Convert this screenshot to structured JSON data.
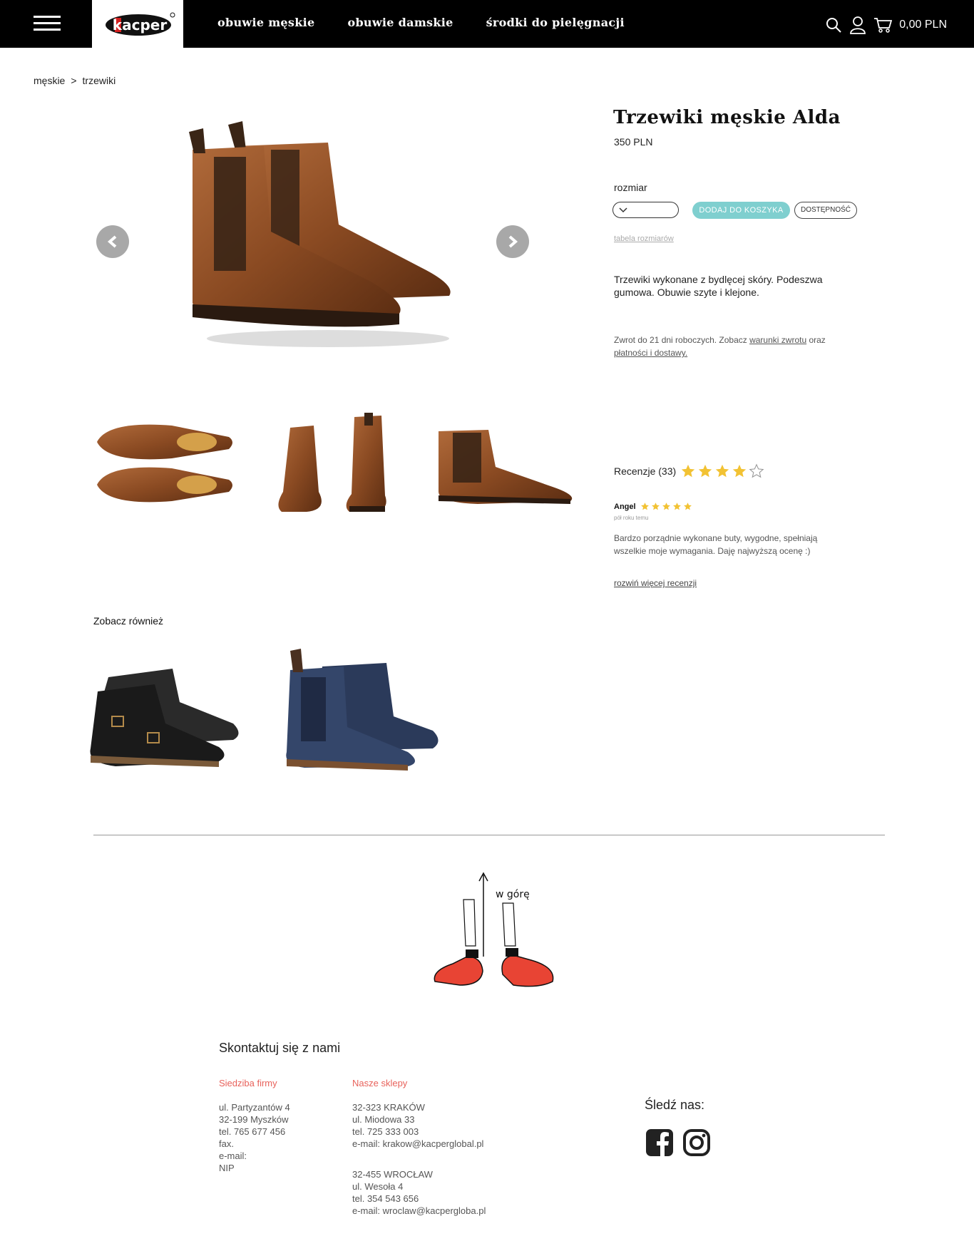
{
  "header": {
    "logo_text": "kacper",
    "nav": [
      "obuwie męskie",
      "obuwie damskie",
      "środki do pielęgnacji"
    ],
    "cart_total": "0,00 PLN"
  },
  "breadcrumb": {
    "items": [
      "męskie",
      "trzewiki"
    ],
    "separator": ">"
  },
  "product": {
    "title": "Trzewiki męskie Alda",
    "price": "350 PLN",
    "size_label": "rozmiar",
    "add_to_cart": "DODAJ DO KOSZYKA",
    "availability": "DOSTĘPNOŚĆ",
    "size_table": "tabela rozmiarów",
    "description": "Trzewiki wykonane z bydlęcej skóry. Podeszwa gumowa. Obuwie szyte i klejone.",
    "return_prefix": "Zwrot do 21 dni roboczych. Zobacz ",
    "return_link1": "warunki zwrotu",
    "return_mid": " oraz ",
    "return_link2": "płatności i dostawy."
  },
  "reviews": {
    "label": "Recenzje (33)",
    "rating": 4,
    "max_rating": 5,
    "items": [
      {
        "author": "Angel",
        "rating": 5,
        "time": "pół roku temu",
        "text": "Bardzo porządnie wykonane buty, wygodne, spełniają wszelkie moje wymagania. Daję najwyższą ocenę :)"
      }
    ],
    "more_link": "rozwiń więcej recenzji"
  },
  "related": {
    "title": "Zobacz również"
  },
  "back_to_top": "w górę",
  "footer": {
    "contact_title": "Skontaktuj się z nami",
    "hq_title": "Siedziba firmy",
    "hq_lines": "ul. Partyzantów 4\n32-199 Myszków\ntel. 765 677 456\nfax.\ne-mail:\nNIP",
    "stores_title": "Nasze sklepy",
    "store1_lines": "32-323 KRAKÓW\nul. Miodowa 33\ntel. 725 333 003\ne-mail: krakow@kacperglobal.pl",
    "store2_lines": "32-455  WROCŁAW\nul. Wesoła 4\ntel. 354 543 656\ne-mail: wroclaw@kacpergloba.pl",
    "follow_label": "Śledź nas:"
  },
  "colors": {
    "accent_teal": "#7fcfcf",
    "star_gold": "#f2c233",
    "footer_heading": "#e8625b",
    "shoe_brown": "#8a4a22"
  }
}
